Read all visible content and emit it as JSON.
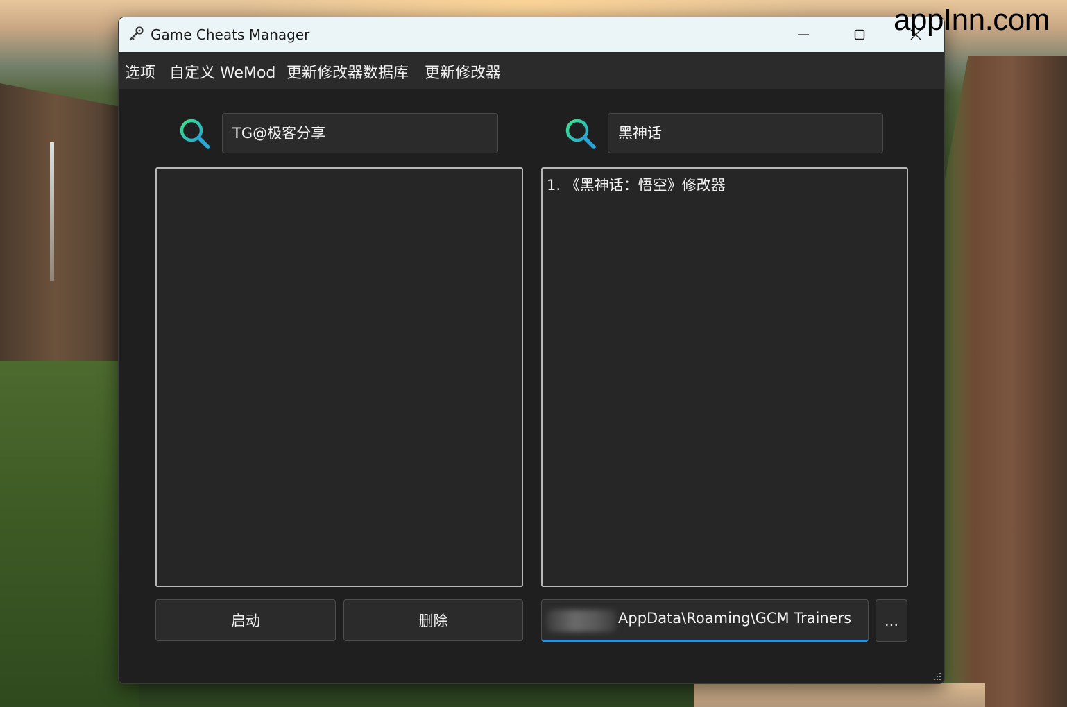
{
  "watermark": "appInn.com",
  "window": {
    "title": "Game Cheats Manager",
    "app_icon": "key-icon",
    "controls": {
      "minimize_icon": "minimize-icon",
      "maximize_icon": "maximize-icon",
      "close_icon": "close-icon"
    }
  },
  "menu": {
    "items": [
      {
        "label": "选项"
      },
      {
        "label": "自定义 WeMod"
      },
      {
        "label": "更新修改器数据库"
      },
      {
        "label": "更新修改器"
      }
    ]
  },
  "left_panel": {
    "search_icon": "search-icon",
    "search_value": "TG@极客分享",
    "list_items": []
  },
  "right_panel": {
    "search_icon": "search-icon",
    "search_value": "黑神话",
    "list_items": [
      {
        "text": "1. 《黑神话：悟空》修改器"
      }
    ]
  },
  "buttons": {
    "launch_label": "启动",
    "delete_label": "删除",
    "browse_label": "..."
  },
  "download_path": {
    "visible_text": "AppData\\Roaming\\GCM Trainers"
  },
  "colors": {
    "accent_teal": "#2fc7c0",
    "accent_blue": "#2f8fd8",
    "window_bg": "#1f1f1f",
    "menubar_bg": "#2b2b2b",
    "titlebar_bg": "#ebf5f7"
  }
}
